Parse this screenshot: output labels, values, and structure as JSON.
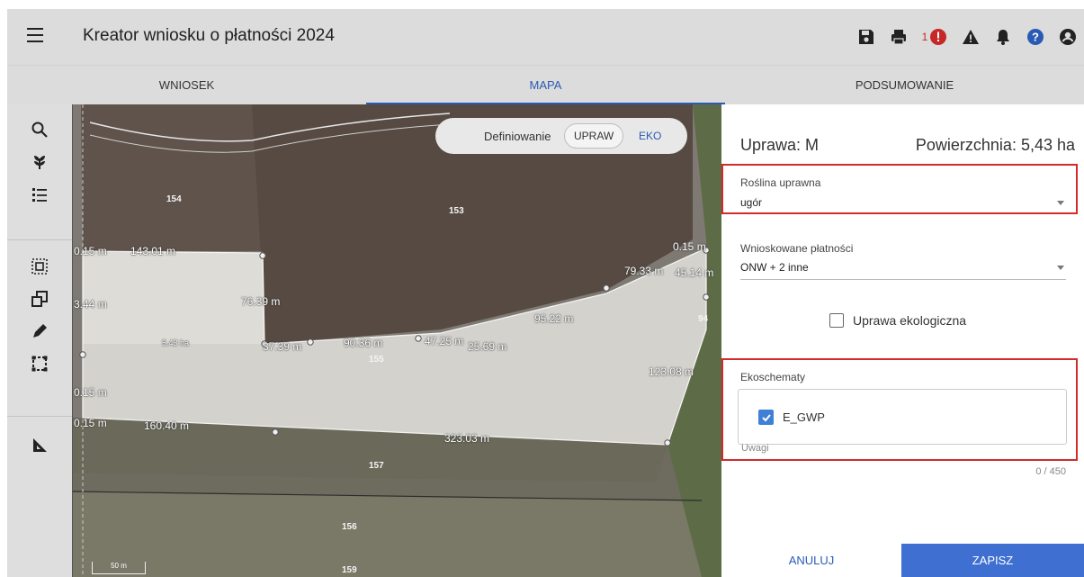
{
  "header": {
    "title": "Kreator wniosku o płatności 2024",
    "error_count": "1"
  },
  "tabs": [
    {
      "label": "WNIOSEK"
    },
    {
      "label": "MAPA"
    },
    {
      "label": "PODSUMOWANIE"
    }
  ],
  "map": {
    "mode_label": "Definiowanie",
    "mode_upraw": "UPRAW",
    "mode_eko": "EKO",
    "parcels": [
      "154",
      "153",
      "155",
      "157",
      "156",
      "159",
      "94"
    ],
    "area_label": "5.43 ha",
    "scale": "50 m",
    "measurements": {
      "m1": "0.15 m",
      "m2": "143.01 m",
      "m3": "0.15 m",
      "m4": "79.33 m",
      "m5": "45.14 m",
      "m6": "3.44 m",
      "m7": "76.39 m",
      "m8": "95.22 m",
      "m9": "37.39 m",
      "m10": "90.36 m",
      "m11": "47.25 m",
      "m12": "25.69 m",
      "m13": "123.08 m",
      "m14": "0.15 m",
      "m15": "0.15 m",
      "m16": "160.40 m",
      "m17": "323.03 m"
    }
  },
  "panel": {
    "title": "Uprawa: M",
    "area": "Powierzchnia: 5,43 ha",
    "crop_label": "Roślina uprawna",
    "crop_value": "ugór",
    "payments_label": "Wnioskowane płatności",
    "payments_value": "ONW + 2 inne",
    "eco_checkbox_label": "Uprawa ekologiczna",
    "ecoschemes_label": "Ekoschematy",
    "ecoscheme_item": "E_GWP",
    "notes_label": "Uwagi",
    "notes_counter": "0 / 450",
    "cancel": "ANULUJ",
    "save": "ZAPISZ"
  },
  "colors": {
    "accent": "#2a5bb4",
    "save_button": "#3f6fd1",
    "highlight": "#d42a2a",
    "checkbox": "#3f7fd6",
    "error_icon": "#c62828",
    "help_icon": "#2a5bb4"
  },
  "icons": {
    "header": [
      "menu-icon",
      "save-icon",
      "print-icon",
      "error-icon",
      "warning-icon",
      "bell-icon",
      "help-icon",
      "account-icon"
    ],
    "left": [
      "search-icon",
      "plant-icon",
      "list-icon",
      "select-area-icon",
      "copy-icon",
      "pencil-icon",
      "rectangle-icon",
      "ruler-icon"
    ]
  }
}
